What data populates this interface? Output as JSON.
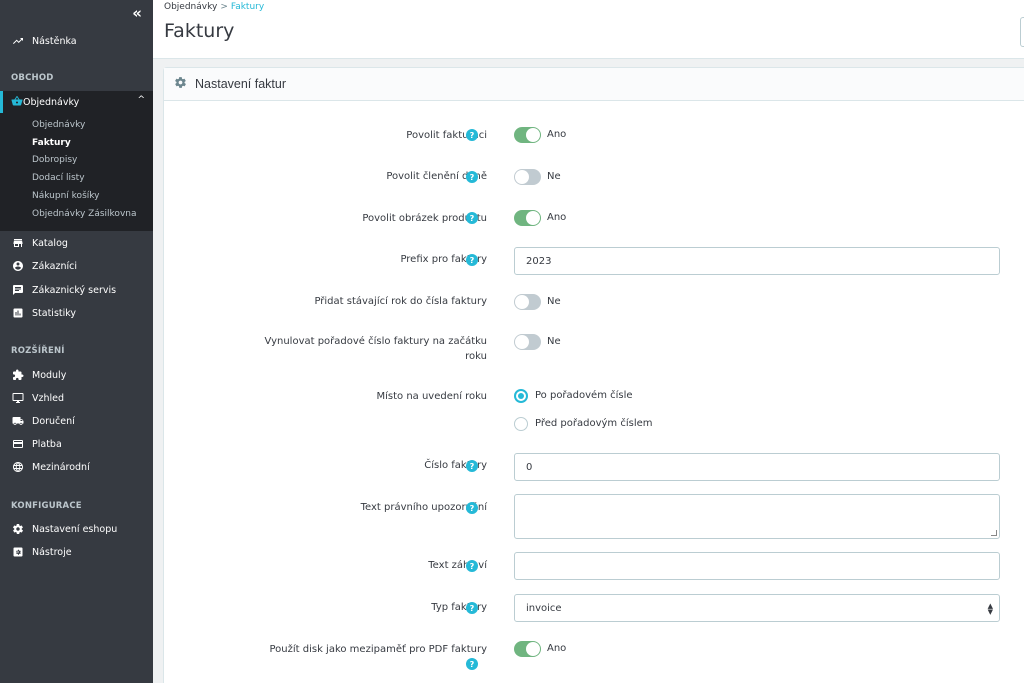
{
  "sidebar": {
    "collapse_glyph": "«",
    "dashboard": "Nástěnka",
    "sections": {
      "obchod": "OBCHOD",
      "rozsireni": "ROZŠÍŘENÍ",
      "konfigurace": "KONFIGURACE"
    },
    "orders": {
      "label": "Objednávky",
      "chevron": "^",
      "sub": [
        "Objednávky",
        "Faktury",
        "Dobropisy",
        "Dodací listy",
        "Nákupní košíky",
        "Objednávky Zásilkovna"
      ]
    },
    "items_obchod": [
      "Katalog",
      "Zákazníci",
      "Zákaznický servis",
      "Statistiky"
    ],
    "items_rozsireni": [
      "Moduly",
      "Vzhled",
      "Doručení",
      "Platba",
      "Mezinárodní"
    ],
    "items_konfigurace": [
      "Nastavení eshopu",
      "Nástroje"
    ],
    "accent_color": "#25b9d7"
  },
  "header": {
    "breadcrumb_parent": "Objednávky",
    "breadcrumb_sep": ">",
    "breadcrumb_current": "Faktury",
    "title": "Faktury"
  },
  "panel": {
    "title": "Nastavení faktur",
    "help_glyph": "?",
    "fields": {
      "enable_invoices": {
        "label": "Povolit fakturaci",
        "value": "Ano"
      },
      "tax_breakdown": {
        "label": "Povolit členění daně",
        "value": "Ne"
      },
      "product_image": {
        "label": "Povolit obrázek produktu",
        "value": "Ano"
      },
      "prefix": {
        "label": "Prefix pro faktury",
        "value": "2023"
      },
      "add_year": {
        "label": "Přidat stávající rok do čísla faktury",
        "value": "Ne"
      },
      "reset_number_line1": "Vynulovat pořadové číslo faktury na začátku",
      "reset_number_line2": "roku",
      "reset_number_value": "Ne",
      "year_position": {
        "label": "Místo na uvedení roku",
        "options": [
          "Po pořadovém čísle",
          "Před pořadovým číslem"
        ]
      },
      "invoice_number": {
        "label": "Číslo faktury",
        "value": "0"
      },
      "legal_text": {
        "label": "Text právního upozornění",
        "value": ""
      },
      "header_text": {
        "label": "Text záhlaví",
        "value": ""
      },
      "invoice_type": {
        "label": "Typ faktury",
        "value": "invoice"
      },
      "disk_cache": {
        "label": "Použít disk jako mezipaměť pro PDF faktury",
        "value": "Ano"
      }
    },
    "switch_on_color": "#70b580",
    "switch_off_color": "#c1cbd1"
  }
}
